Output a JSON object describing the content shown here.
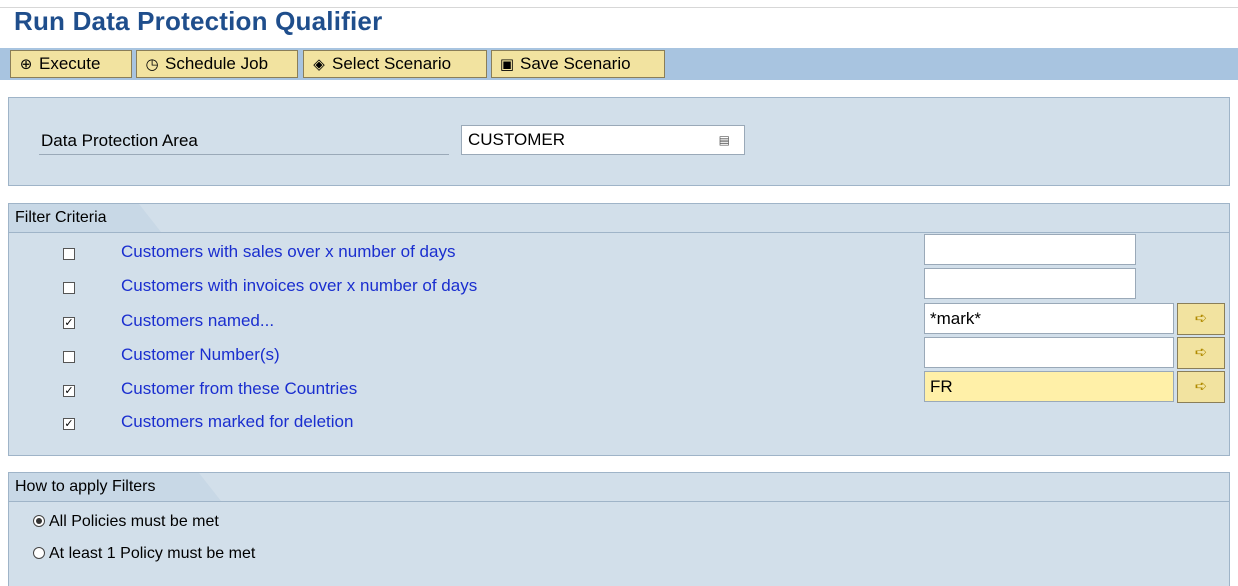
{
  "page": {
    "title": "Run Data Protection Qualifier"
  },
  "toolbar": {
    "buttons": [
      {
        "label": "Execute",
        "icon": "execute-icon",
        "glyph": "⊕"
      },
      {
        "label": "Schedule Job",
        "icon": "clock-icon",
        "glyph": "◷"
      },
      {
        "label": "Select Scenario",
        "icon": "select-scenario-icon",
        "glyph": "◈"
      },
      {
        "label": "Save Scenario",
        "icon": "save-scenario-icon",
        "glyph": "▣"
      }
    ]
  },
  "area": {
    "label": "Data Protection Area",
    "value": "CUSTOMER",
    "help_glyph": "▤"
  },
  "filters": {
    "title": "Filter Criteria",
    "items": [
      {
        "label": "Customers with sales over x number of days",
        "checked": false,
        "value": "",
        "has_multi": false
      },
      {
        "label": "Customers with invoices over x number of days",
        "checked": false,
        "value": "",
        "has_multi": false
      },
      {
        "label": "Customers named...",
        "checked": true,
        "value": "*mark*",
        "has_multi": true
      },
      {
        "label": "Customer Number(s)",
        "checked": false,
        "value": "",
        "has_multi": true
      },
      {
        "label": "Customer from these Countries",
        "checked": true,
        "value": "FR",
        "has_multi": true
      },
      {
        "label": "Customers marked for deletion",
        "checked": true,
        "value": null,
        "has_multi": false
      }
    ],
    "multi_glyph": "➪",
    "check_glyph": "✓"
  },
  "apply": {
    "title": "How to apply Filters",
    "options": [
      {
        "label": "All Policies must be met",
        "selected": true
      },
      {
        "label": "At least 1 Policy must be met",
        "selected": false
      }
    ]
  },
  "colors": {
    "title": "#1f4e8c",
    "toolbar": "#a8c4e0",
    "button": "#f2e3a0",
    "panel": "#d2dfea",
    "link": "#1a2ecf",
    "highlight": "#fff0a8"
  }
}
